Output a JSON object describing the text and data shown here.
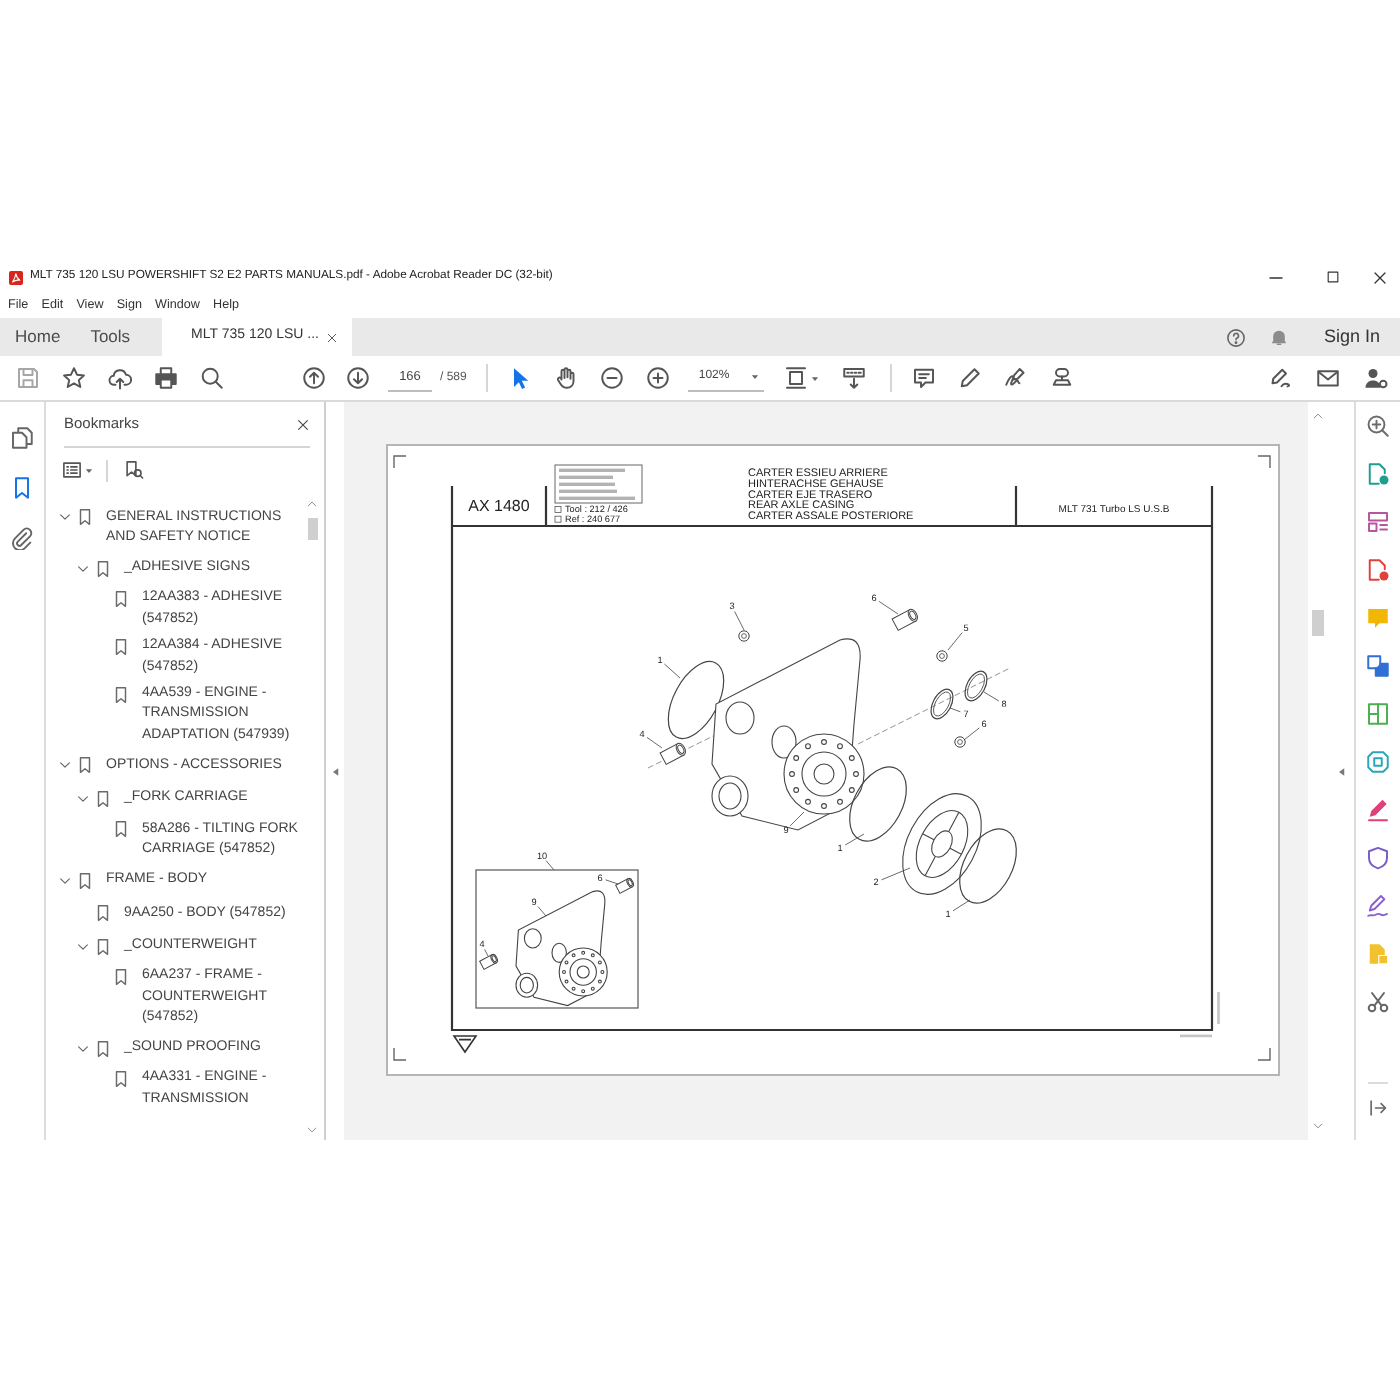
{
  "window": {
    "title": "MLT 735 120 LSU POWERSHIFT S2 E2 PARTS MANUALS.pdf - Adobe Acrobat Reader DC (32-bit)"
  },
  "menu": [
    "File",
    "Edit",
    "View",
    "Sign",
    "Window",
    "Help"
  ],
  "tabs": [
    {
      "label": "Home",
      "kind": "nav",
      "selected": false
    },
    {
      "label": "Tools",
      "kind": "nav",
      "selected": false
    },
    {
      "label": "MLT 735 120 LSU ...",
      "kind": "document",
      "selected": true
    }
  ],
  "account": {
    "sign_in": "Sign In"
  },
  "toolbar": {
    "page": "166",
    "page_total": "/ 589",
    "pointer_tools": [
      {
        "selected": true
      },
      {
        "selected": false
      }
    ],
    "zoom": "102%"
  },
  "side_rail": [
    {
      "selected": false
    },
    {
      "selected": true
    },
    {
      "selected": false
    }
  ],
  "bookmarks": {
    "title": "Bookmarks",
    "items": [
      {
        "label": "GENERAL INSTRUCTIONS AND SAFETY NOTICE",
        "expanded": true,
        "children": [
          {
            "label": "_ADHESIVE SIGNS",
            "expanded": true,
            "children": [
              {
                "label": "12AA383 - ADHESIVE (547852)"
              },
              {
                "label": "12AA384 - ADHESIVE (547852)"
              },
              {
                "label": "4AA539 - ENGINE - TRANSMISSION ADAPTATION (547939)"
              }
            ]
          }
        ]
      },
      {
        "label": "OPTIONS - ACCESSORIES",
        "expanded": true,
        "children": [
          {
            "label": "_FORK CARRIAGE",
            "expanded": true,
            "children": [
              {
                "label": "58A286 - TILTING FORK CARRIAGE (547852)"
              }
            ]
          }
        ]
      },
      {
        "label": "FRAME - BODY",
        "expanded": true,
        "children": [
          {
            "label": "9AA250 - BODY (547852)"
          },
          {
            "label": "_COUNTERWEIGHT",
            "expanded": true,
            "children": [
              {
                "label": "6AA237 - FRAME - COUNTERWEIGHT (547852)"
              }
            ]
          },
          {
            "label": "_SOUND PROOFING",
            "expanded": true,
            "children": [
              {
                "label": "4AA331 - ENGINE - TRANSMISSION"
              }
            ]
          }
        ]
      }
    ]
  },
  "document": {
    "code": "AX 1480",
    "info_box": {
      "checks": [
        {
          "label": "Tool : 212 / 426",
          "checked": false
        },
        {
          "label": "Ref : 240 677",
          "checked": false
        }
      ]
    },
    "titles": [
      "CARTER ESSIEU ARRIERE",
      "HINTERACHSE GEHAUSE",
      "CARTER EJE TRASERO",
      "REAR AXLE CASING",
      "CARTER ASSALE POSTERIORE"
    ],
    "model": "MLT 731 Turbo LS U.S.B",
    "callouts": [
      "3",
      "6",
      "5",
      "1",
      "4",
      "8",
      "7",
      "6",
      "9",
      "1",
      "2",
      "1"
    ],
    "inset_callouts": [
      "10",
      "6",
      "9",
      "4"
    ]
  }
}
